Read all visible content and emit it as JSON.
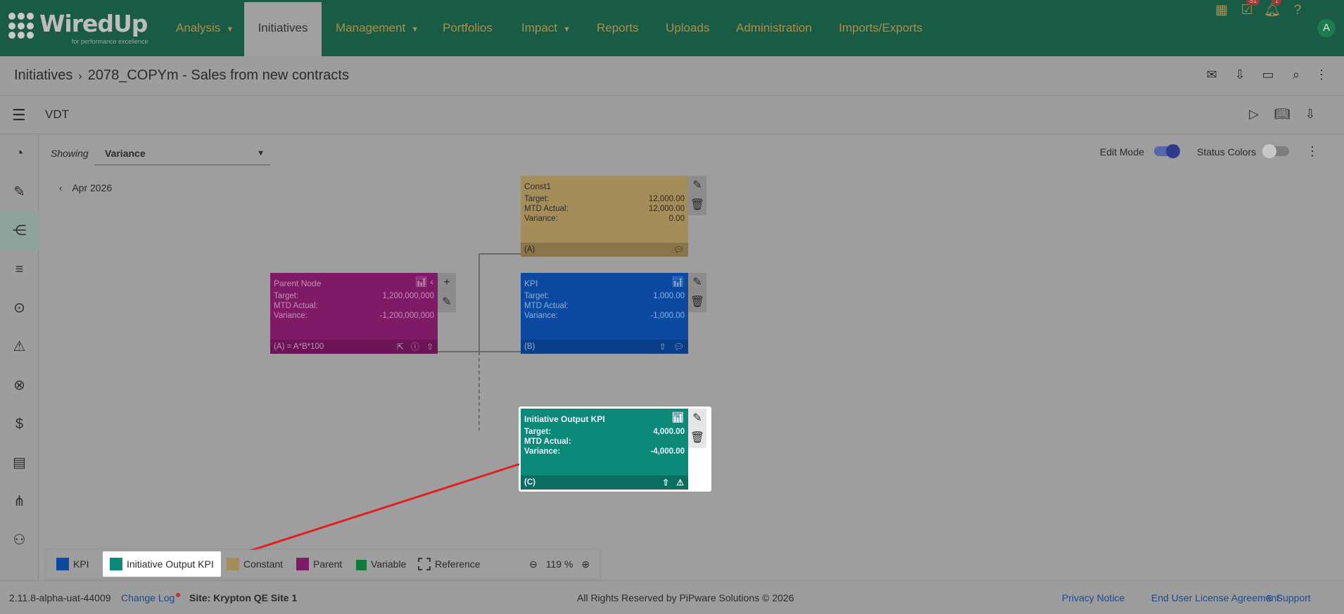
{
  "brand": {
    "name": "WiredUp",
    "tagline": "for performance excellence"
  },
  "nav": {
    "items": [
      {
        "label": "Analysis",
        "has_caret": true
      },
      {
        "label": "Initiatives",
        "active": true
      },
      {
        "label": "Management",
        "has_caret": true
      },
      {
        "label": "Portfolios"
      },
      {
        "label": "Impact",
        "has_caret": true
      },
      {
        "label": "Reports"
      },
      {
        "label": "Uploads"
      },
      {
        "label": "Administration"
      },
      {
        "label": "Imports/Exports"
      }
    ],
    "tasks_badge": "51",
    "notifications_badge": "1",
    "avatar": "A"
  },
  "breadcrumb": {
    "root": "Initiatives",
    "current": "2078_COPYm - Sales from new contracts"
  },
  "vdt": {
    "title": "VDT"
  },
  "controls": {
    "showing_label": "Showing",
    "showing_value": "Variance",
    "edit_mode_label": "Edit Mode",
    "status_colors_label": "Status Colors",
    "period": "Apr 2026"
  },
  "nodes": {
    "const": {
      "name": "Const1",
      "target_label": "Target:",
      "target": "12,000.00",
      "actual_label": "MTD Actual:",
      "actual": "12,000.00",
      "variance_label": "Variance:",
      "variance": "0.00",
      "footer": "(A)"
    },
    "kpi": {
      "name": "KPI",
      "target_label": "Target:",
      "target": "1,000.00",
      "actual_label": "MTD Actual:",
      "actual": "",
      "variance_label": "Variance:",
      "variance": "-1,000.00",
      "footer": "(B)"
    },
    "parent": {
      "name": "Parent Node",
      "target_label": "Target:",
      "target": "1,200,000,000",
      "actual_label": "MTD Actual:",
      "actual": "",
      "variance_label": "Variance:",
      "variance": "-1,200,000,000",
      "footer": "(A) = A*B*100"
    },
    "iokpi": {
      "name": "Initiative Output KPI",
      "target_label": "Target:",
      "target": "4,000.00",
      "actual_label": "MTD Actual:",
      "actual": "",
      "variance_label": "Variance:",
      "variance": "-4,000.00",
      "footer": "(C)"
    }
  },
  "legend": {
    "items": [
      {
        "label": "KPI",
        "color": "#0b4aa0"
      },
      {
        "label": "Initiative Output KPI",
        "color": "#0c8a79"
      },
      {
        "label": "Constant",
        "color": "#a58c5b"
      },
      {
        "label": "Parent",
        "color": "#7f1a66"
      },
      {
        "label": "Variable",
        "color": "#127a3d"
      },
      {
        "label": "Reference",
        "color": "dashed"
      }
    ],
    "zoom": "119 %"
  },
  "footer": {
    "version": "2.11.8-alpha-uat-44009",
    "changelog": "Change Log",
    "site": "Site: Krypton QE Site 1",
    "copyright": "All Rights Reserved by PiPware Solutions © 2026",
    "privacy": "Privacy Notice",
    "eula": "End User License Agreement",
    "support": "Support"
  }
}
